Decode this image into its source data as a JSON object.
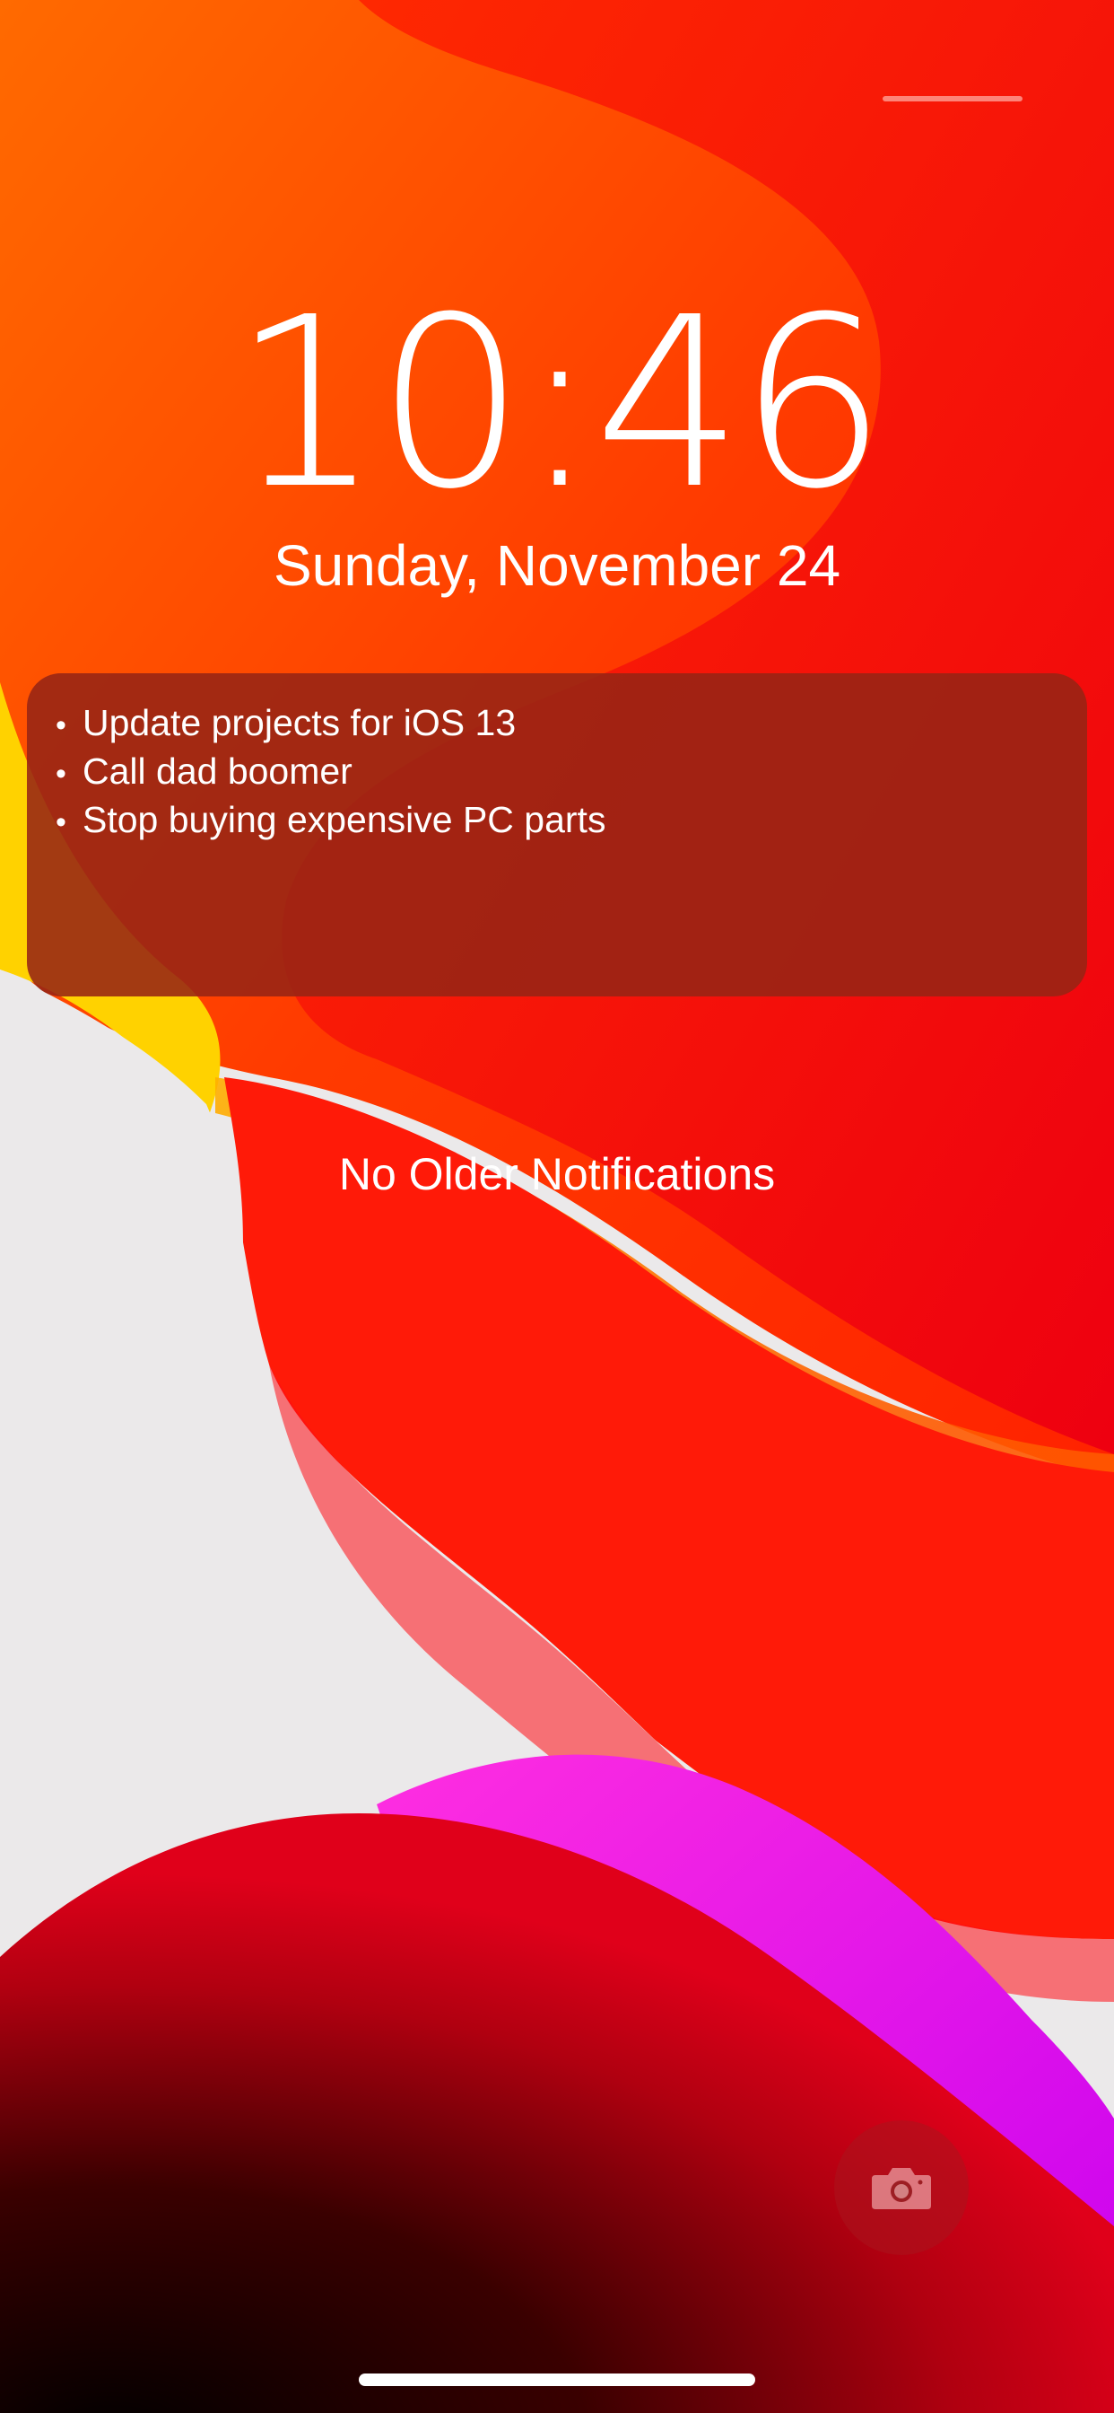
{
  "lock_screen": {
    "time": "10:46",
    "date": "Sunday, November 24"
  },
  "notes_widget": {
    "bullet": "•",
    "items": [
      "Update projects for iOS 13",
      "Call dad boomer",
      "Stop buying expensive PC parts"
    ]
  },
  "notification_center": {
    "empty_label": "No Older Notifications"
  },
  "icons": {
    "camera": "camera-icon",
    "control_center": "control-center-indicator",
    "home": "home-indicator"
  },
  "colors": {
    "wallpaper_red": "#ff1a0a",
    "wallpaper_orange": "#ff5a00",
    "wallpaper_yellow": "#ffd200",
    "wallpaper_magenta": "#e020f0",
    "wallpaper_light": "#ebe9ea",
    "widget_background": "#962414",
    "text": "#ffffff"
  }
}
